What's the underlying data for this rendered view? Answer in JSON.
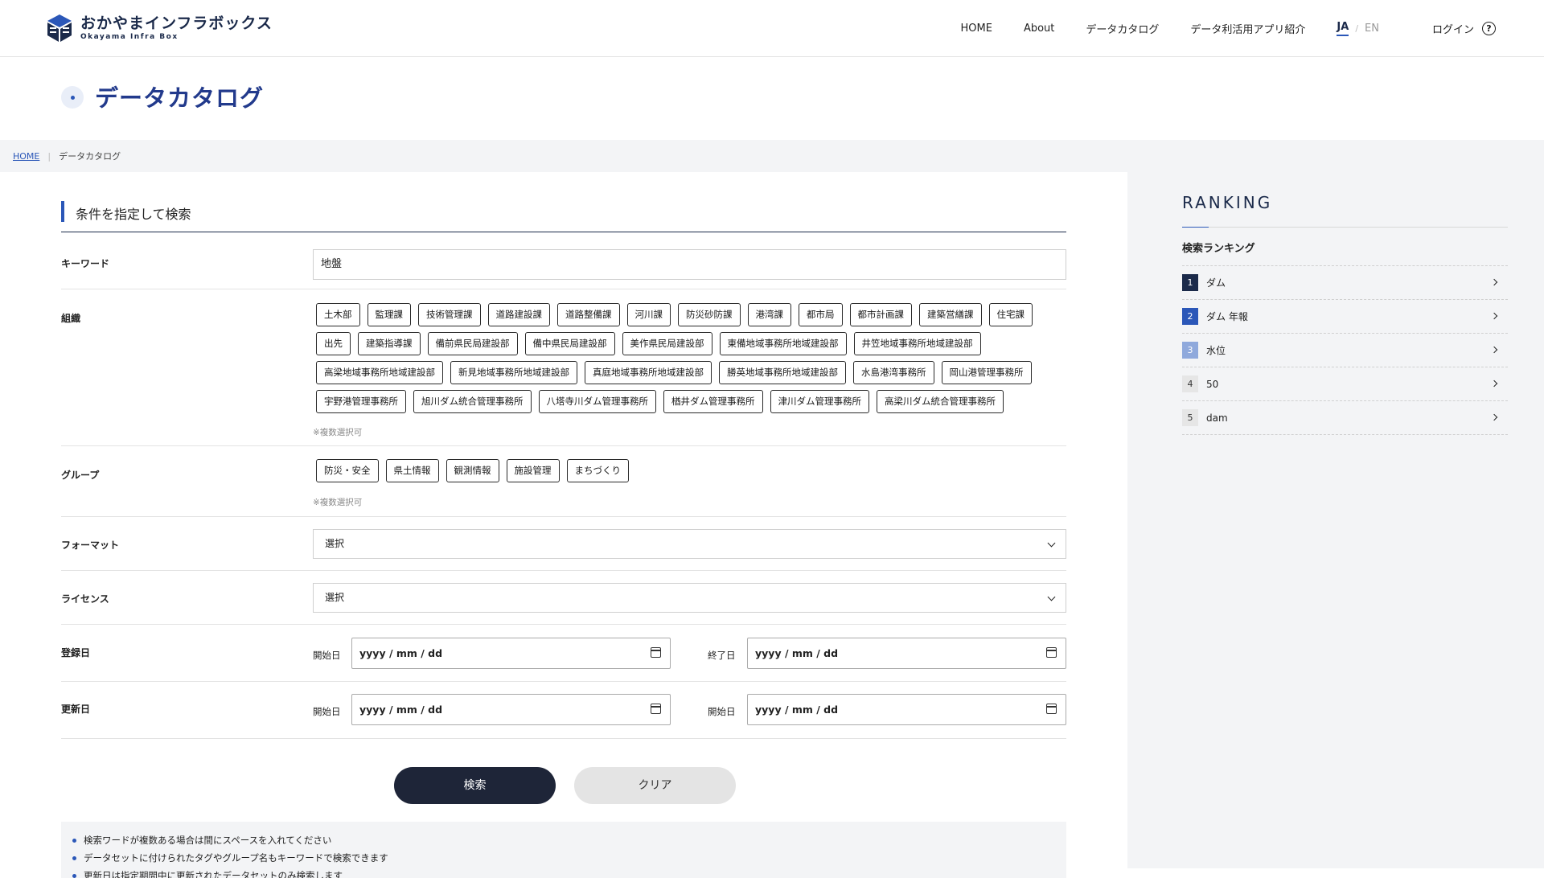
{
  "header": {
    "logo_jp": "おかやまインフラボックス",
    "logo_en": "Okayama Infra Box",
    "nav": [
      "HOME",
      "About",
      "データカタログ",
      "データ利活用アプリ紹介"
    ],
    "lang_ja": "JA",
    "lang_sep": "/",
    "lang_en": "EN",
    "login": "ログイン",
    "help": "?"
  },
  "page_title": "データカタログ",
  "breadcrumb": {
    "home": "HOME",
    "current": "データカタログ"
  },
  "search": {
    "section_title": "条件を指定して検索",
    "keyword_label": "キーワード",
    "keyword_value": "地盤",
    "org_label": "組織",
    "orgs": [
      "土木部",
      "監理課",
      "技術管理課",
      "道路建設課",
      "道路整備課",
      "河川課",
      "防災砂防課",
      "港湾課",
      "都市局",
      "都市計画課",
      "建築営繕課",
      "住宅課",
      "出先",
      "建築指導課",
      "備前県民局建設部",
      "備中県民局建設部",
      "美作県民局建設部",
      "東備地域事務所地域建設部",
      "井笠地域事務所地域建設部",
      "高梁地域事務所地域建設部",
      "新見地域事務所地域建設部",
      "真庭地域事務所地域建設部",
      "勝英地域事務所地域建設部",
      "水島港湾事務所",
      "岡山港管理事務所",
      "宇野港管理事務所",
      "旭川ダム統合管理事務所",
      "八塔寺川ダム管理事務所",
      "楢井ダム管理事務所",
      "津川ダム管理事務所",
      "高梁川ダム統合管理事務所"
    ],
    "multi_note": "※複数選択可",
    "group_label": "グループ",
    "groups": [
      "防災・安全",
      "県土情報",
      "観測情報",
      "施設管理",
      "まちづくり"
    ],
    "format_label": "フォーマット",
    "format_value": "選択",
    "license_label": "ライセンス",
    "license_value": "選択",
    "registered_label": "登録日",
    "registered_start_label": "開始日",
    "registered_end_label": "終了日",
    "updated_label": "更新日",
    "updated_start_label": "開始日",
    "updated_end_label": "開始日",
    "date_placeholder": "yyyy / mm / dd",
    "search_button": "検索",
    "clear_button": "クリア",
    "tips": [
      "検索ワードが複数ある場合は間にスペースを入れてください",
      "データセットに付けられたタグやグループ名もキーワードで検索できます",
      "更新日は指定期間中に更新されたデータセットのみ検索します"
    ]
  },
  "ranking": {
    "title": "RANKING",
    "subtitle": "検索ランキング",
    "items": [
      {
        "rank": "1",
        "name": "ダム",
        "color": "#1b2a4a",
        "text_color": "#ffffff"
      },
      {
        "rank": "2",
        "name": "ダム 年報",
        "color": "#2b57b8",
        "text_color": "#ffffff"
      },
      {
        "rank": "3",
        "name": "水位",
        "color": "#8fa9dc",
        "text_color": "#ffffff"
      },
      {
        "rank": "4",
        "name": "50",
        "color": "#e6e6e6",
        "text_color": "#333333"
      },
      {
        "rank": "5",
        "name": "dam",
        "color": "#e6e6e6",
        "text_color": "#333333"
      }
    ]
  }
}
